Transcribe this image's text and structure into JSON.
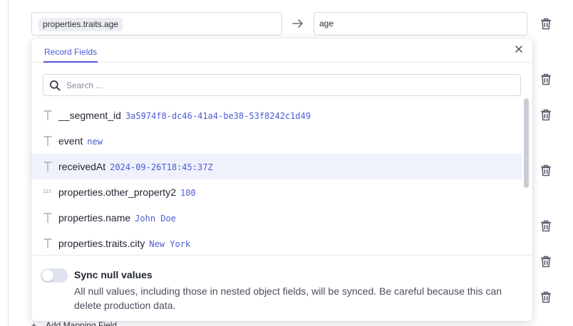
{
  "mapping": {
    "source_chip": "properties.traits.age",
    "target_value": "age"
  },
  "panel": {
    "tab_label": "Record Fields",
    "search_placeholder": "Search ...",
    "fields": [
      {
        "name": "__segment_id",
        "value": "3a5974f8-dc46-41a4-be38-53f8242c1d49",
        "type": "text",
        "selected": false
      },
      {
        "name": "event",
        "value": "new",
        "type": "text",
        "selected": false
      },
      {
        "name": "receivedAt",
        "value": "2024-09-26T18:45:37Z",
        "type": "text",
        "selected": true
      },
      {
        "name": "properties.other_property2",
        "value": "100",
        "type": "number",
        "type_label": "123",
        "selected": false
      },
      {
        "name": "properties.name",
        "value": "John Doe",
        "type": "text",
        "selected": false
      },
      {
        "name": "properties.traits.city",
        "value": "New York",
        "type": "text",
        "selected": false
      }
    ],
    "sync_null": {
      "title": "Sync null values",
      "description": "All null values, including those in nested object fields, will be synced. Be careful because this can delete production data.",
      "enabled": false
    }
  },
  "add_mapping_label": "Add Mapping Field",
  "colors": {
    "accent": "#4b5bd6",
    "icon": "#5a5f6e"
  }
}
